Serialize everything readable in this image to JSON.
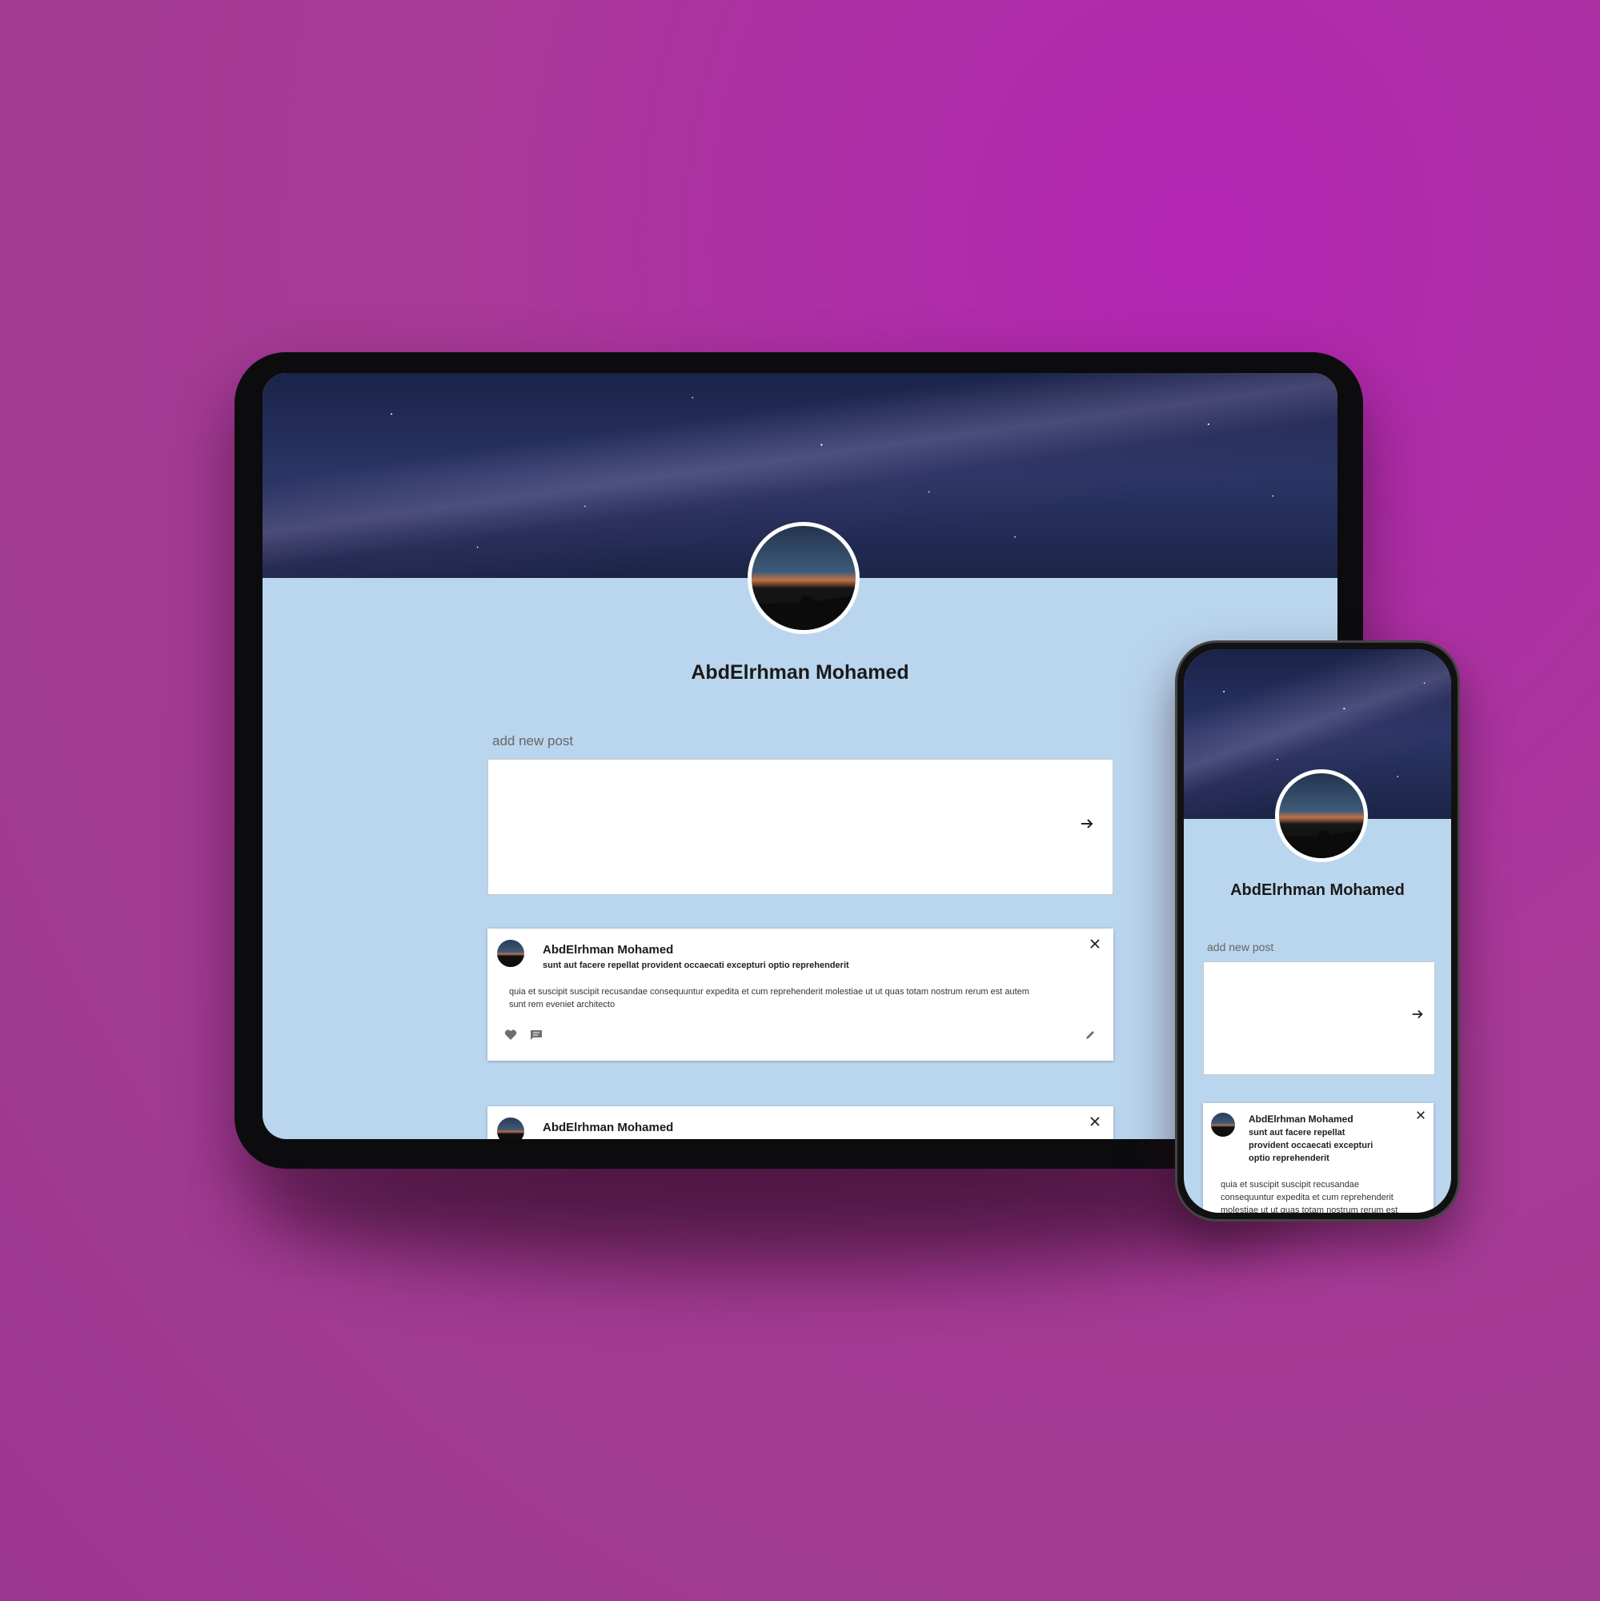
{
  "tablet": {
    "profile_name": "AbdElrhman Mohamed",
    "add_post_label": "add new post",
    "posts": [
      {
        "author": "AbdElrhman Mohamed",
        "title": "sunt aut facere repellat provident occaecati excepturi optio reprehenderit",
        "body_line1": "quia et suscipit suscipit recusandae consequuntur expedita et cum reprehenderit molestiae ut ut quas totam nostrum rerum est autem",
        "body_line2": "sunt rem eveniet architecto"
      },
      {
        "author": "AbdElrhman Mohamed"
      }
    ]
  },
  "phone": {
    "profile_name": "AbdElrhman Mohamed",
    "add_post_label": "add new post",
    "post": {
      "author": "AbdElrhman Mohamed",
      "title_line1": "sunt aut facere repellat",
      "title_line2": "provident occaecati excepturi",
      "title_line3": "optio reprehenderit",
      "body_line1": "quia et suscipit suscipit recusandae",
      "body_line2": "consequuntur expedita et cum reprehenderit",
      "body_line3": "molestiae ut ut quas totam nostrum rerum est"
    }
  },
  "icons": {
    "submit": "arrow-right-icon",
    "close": "close-icon",
    "like": "heart-icon",
    "comment": "comment-icon",
    "edit": "pencil-icon"
  },
  "colors": {
    "background": "#a83a98",
    "profile_bg": "#bad6ee",
    "card_bg": "#ffffff"
  }
}
